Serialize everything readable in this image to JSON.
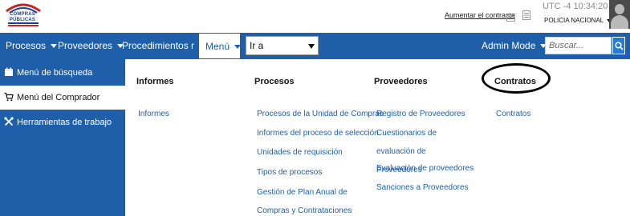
{
  "header": {
    "logo_text": "COMPRAS PÚBLICAS",
    "contrast_link": "Aumentar el contraste",
    "clock": "UTC -4 10:34:20",
    "org": "POLICIA NACIONAL"
  },
  "navbar": {
    "items": [
      "Procesos",
      "Proveedores",
      "Procedimientos recien",
      "Menú"
    ],
    "goto_value": "Ir a",
    "admin_mode": "Admin Mode",
    "search_placeholder": "Buscar..."
  },
  "sidebar": {
    "items": [
      "Menú de búsqueda",
      "Menú del Comprador",
      "Herramientas de trabajo"
    ],
    "active_index": 1
  },
  "mega_menu": {
    "columns": [
      {
        "title": "Informes",
        "links": [
          "Informes"
        ]
      },
      {
        "title": "Procesos",
        "links": [
          "Procesos de la Unidad de Compras",
          "Informes del proceso de selección",
          "Unidades de requisición",
          "Tipos de procesos",
          "Gestión de Plan Anual de Compras y Contrataciones"
        ]
      },
      {
        "title": "Proveedores",
        "links": [
          "Registro de Proveedores",
          "Cuestionarios de evaluación de Proveedores",
          "Evaluación de proveedores",
          "Sanciones a Proveedores"
        ]
      },
      {
        "title": "Contratos",
        "links": [
          "Contratos"
        ]
      }
    ]
  },
  "colors": {
    "brand_blue": "#1f5fa9",
    "link_blue": "#1f5fa9"
  }
}
